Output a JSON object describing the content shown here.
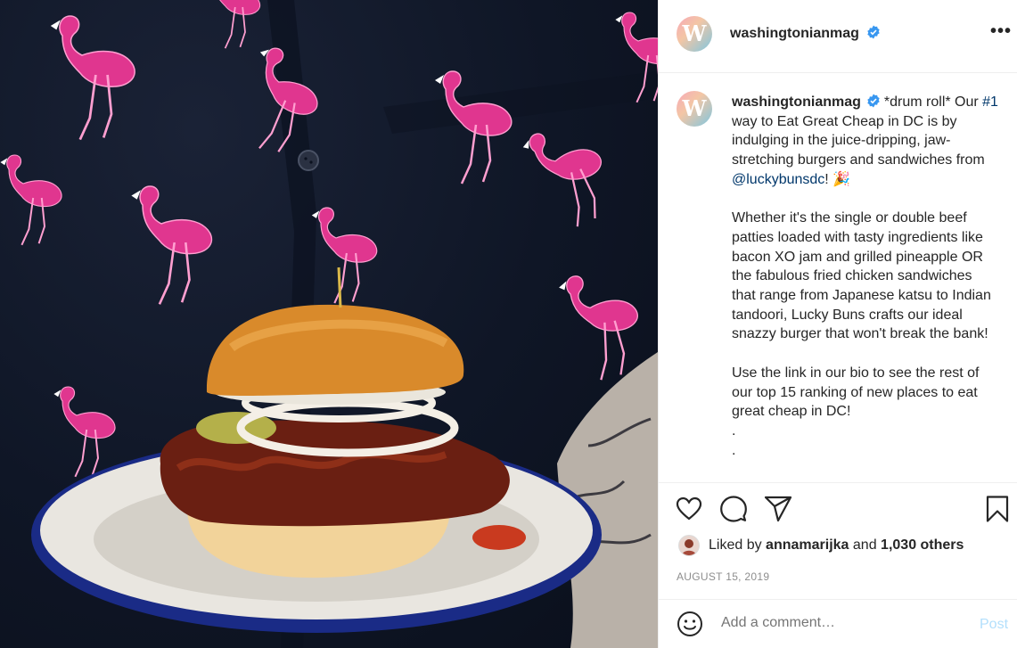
{
  "post": {
    "username": "washingtonianmag",
    "avatar_letter": "W",
    "verified_icon": "verified-badge-icon",
    "more_label": "•••"
  },
  "caption": {
    "username": "washingtonianmag",
    "intro_start": "*drum roll* Our ",
    "rank_link": "#1",
    "intro_mid": " way to Eat Great Cheap in DC is by indulging in the juice-dripping, jaw-stretching burgers and sandwiches from ",
    "mention_link": "@luckybunsdc",
    "intro_end": "! 🎉",
    "para2": "Whether it's the single or double beef patties loaded with tasty ingredients like bacon XO jam and grilled pineapple OR the fabulous fried chicken sandwiches that range from Japanese katsu to Indian tandoori, Lucky Buns crafts our ideal snazzy burger that won't break the bank!",
    "para3": "Use the link in our bio to see the rest of our top 15 ranking of new places to eat great cheap in DC!",
    "dot1": ".",
    "dot2": "."
  },
  "actions": {
    "icons": [
      "heart-icon",
      "comment-icon",
      "share-icon",
      "bookmark-icon"
    ]
  },
  "likes": {
    "prefix": "Liked by",
    "user": "annamarijka",
    "conj": "and",
    "others": "1,030 others"
  },
  "date": "AUGUST 15, 2019",
  "comment": {
    "placeholder": "Add a comment…",
    "post_label": "Post"
  },
  "colors": {
    "link": "#00376b",
    "verified": "#3897f0",
    "post_disabled": "#b2dffc",
    "muted": "#8e8e8e",
    "flamingo": "#e0368f"
  }
}
